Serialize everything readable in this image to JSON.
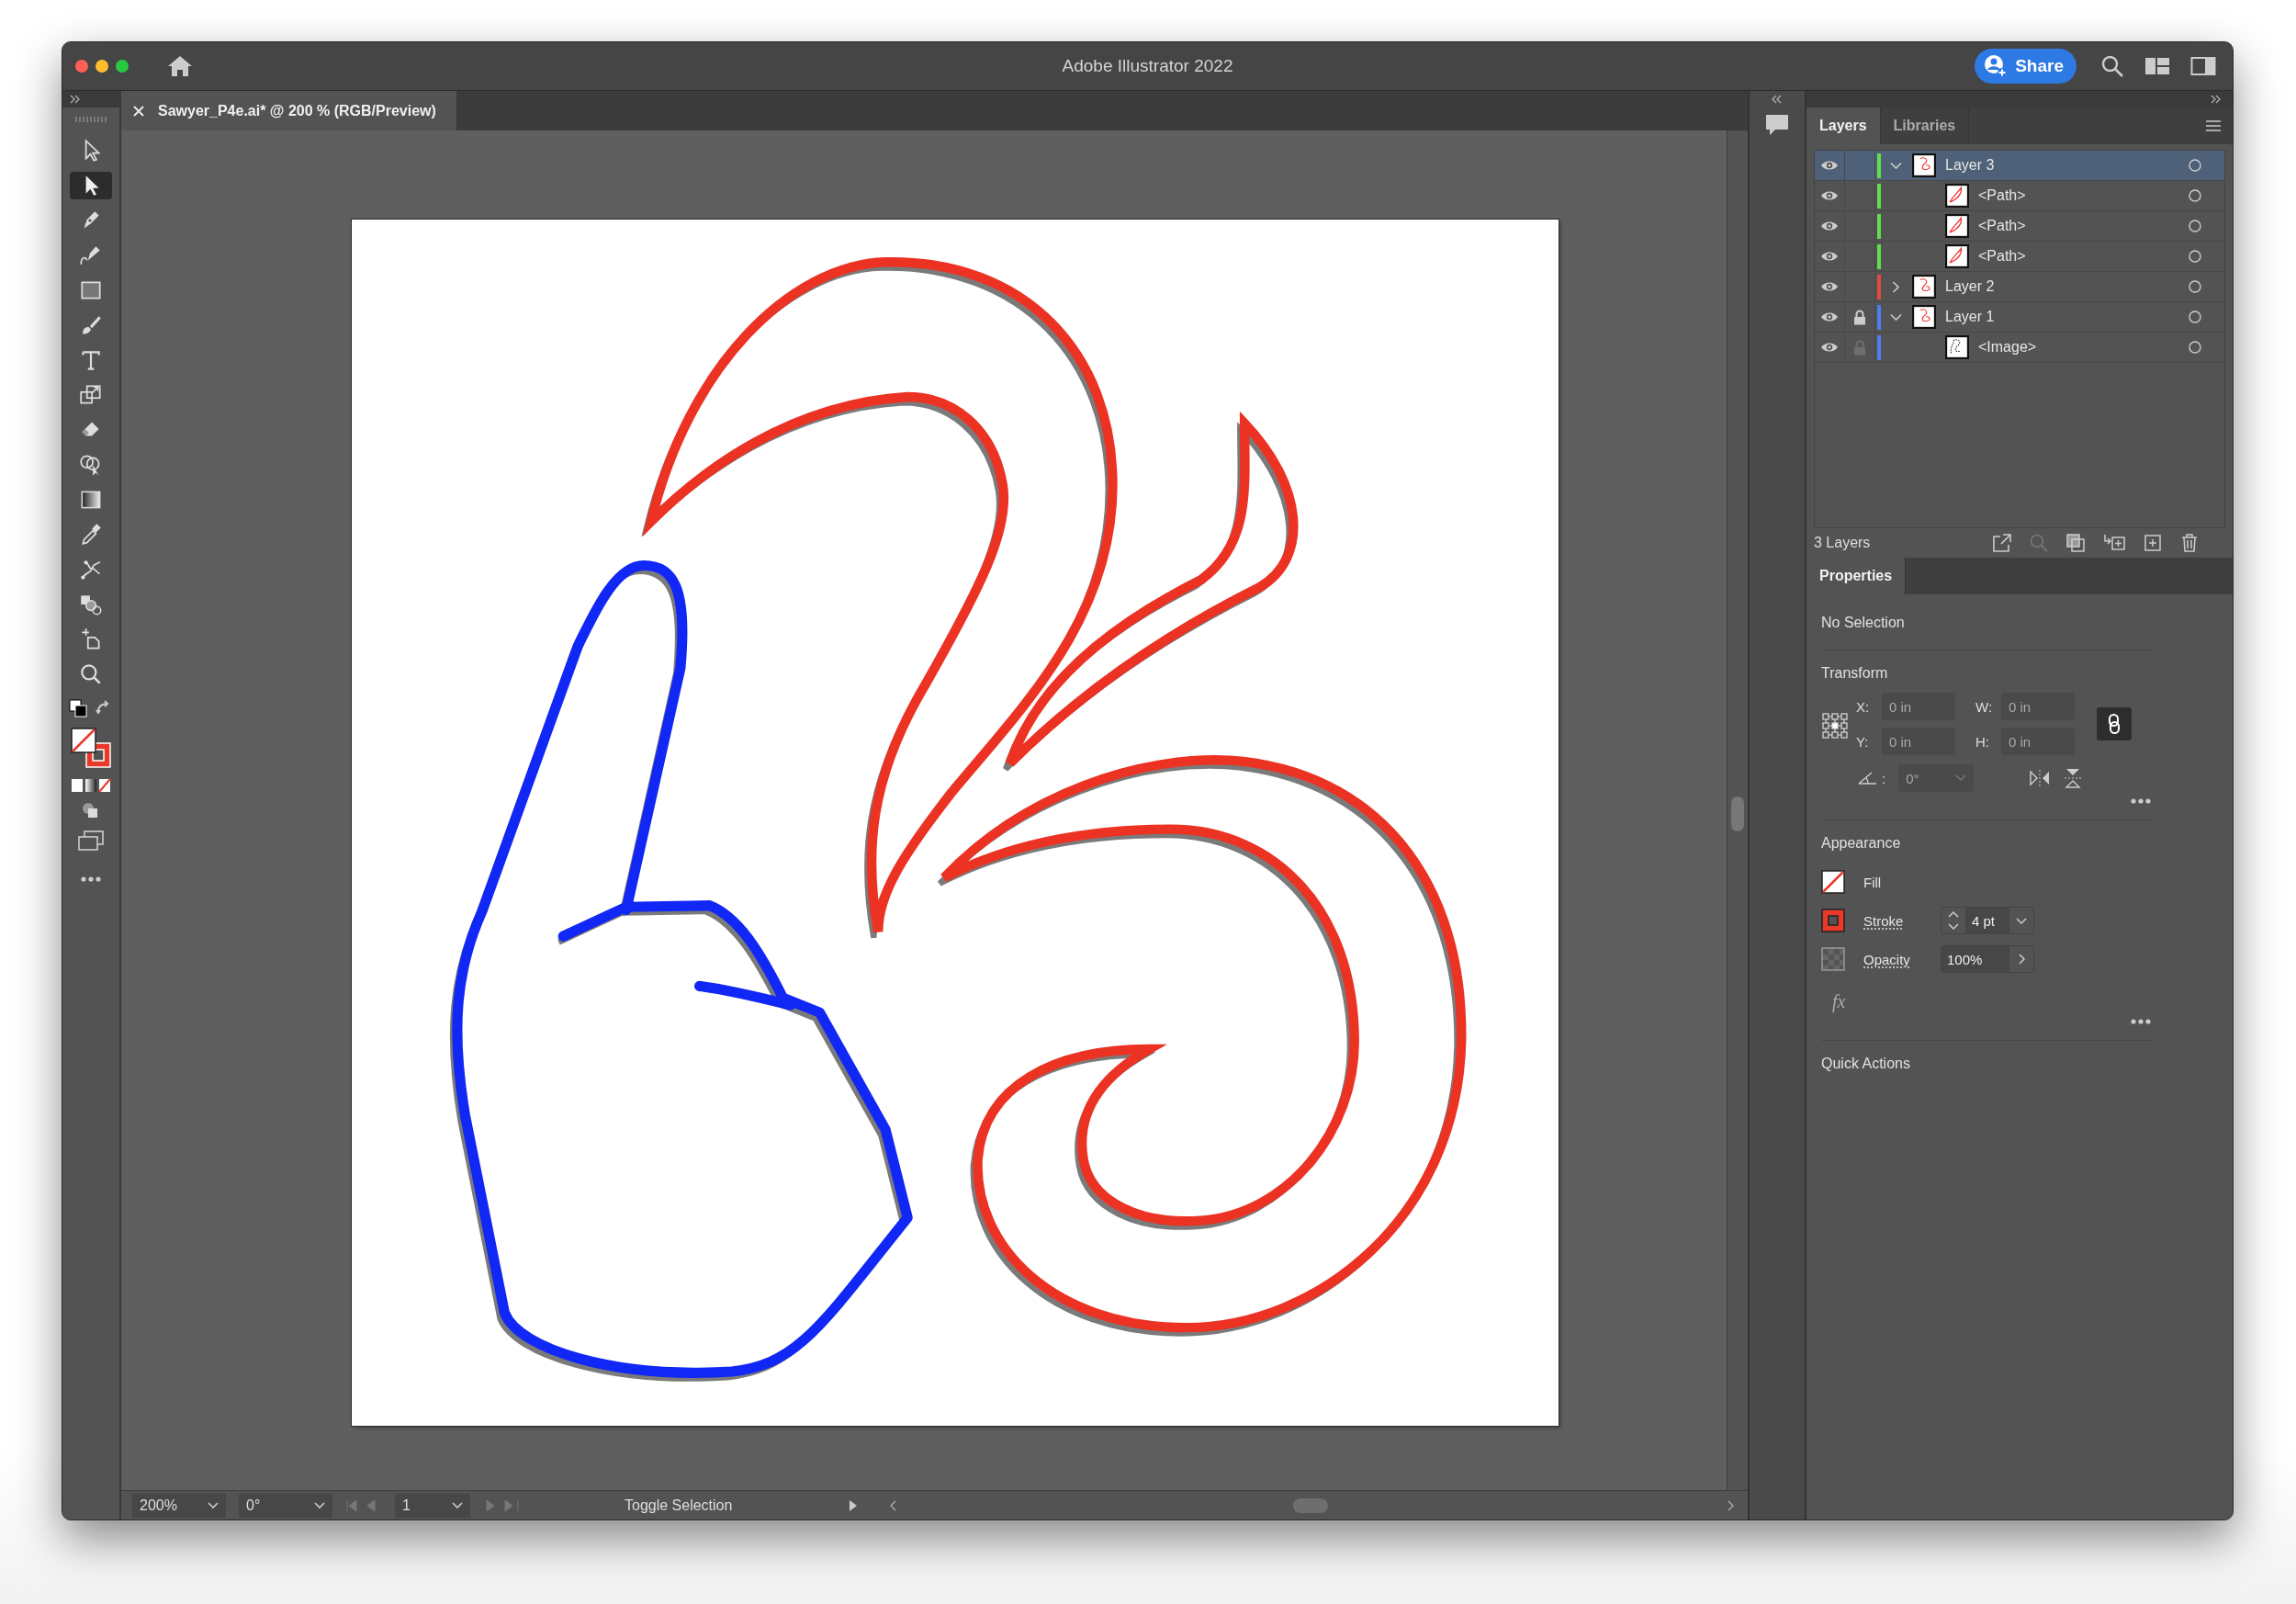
{
  "window": {
    "title": "Adobe Illustrator 2022"
  },
  "share_button": {
    "label": "Share"
  },
  "document_tab": {
    "title": "Sawyer_P4e.ai* @ 200 % (RGB/Preview)"
  },
  "tools": [
    {
      "kind": "selection",
      "selected": false
    },
    {
      "kind": "direct-selection",
      "selected": true
    },
    {
      "kind": "pen",
      "selected": false
    },
    {
      "kind": "curvature",
      "selected": false
    },
    {
      "kind": "rectangle",
      "selected": false
    },
    {
      "kind": "paintbrush",
      "selected": false
    },
    {
      "kind": "type",
      "selected": false
    },
    {
      "kind": "scale",
      "selected": false
    },
    {
      "kind": "eraser",
      "selected": false
    },
    {
      "kind": "shape-builder",
      "selected": false
    },
    {
      "kind": "gradient",
      "selected": false
    },
    {
      "kind": "eyedropper",
      "selected": false
    },
    {
      "kind": "puppet-warp",
      "selected": false
    },
    {
      "kind": "shapes",
      "selected": false
    },
    {
      "kind": "artboard",
      "selected": false
    },
    {
      "kind": "zoom",
      "selected": false
    }
  ],
  "layers_panel": {
    "tabs": [
      {
        "label": "Layers",
        "selected": true
      },
      {
        "label": "Libraries",
        "selected": false
      }
    ],
    "layers": [
      {
        "name": "Layer 3",
        "kind": "layer",
        "color": "#5fe04c",
        "visible": true,
        "locked": false,
        "expanded": true,
        "selected": true,
        "children": [
          {
            "name": "<Path>",
            "kind": "path",
            "color": "#5fe04c",
            "visible": true,
            "locked": false,
            "selected": false
          },
          {
            "name": "<Path>",
            "kind": "path",
            "color": "#5fe04c",
            "visible": true,
            "locked": false,
            "selected": false
          },
          {
            "name": "<Path>",
            "kind": "path",
            "color": "#5fe04c",
            "visible": true,
            "locked": false,
            "selected": false
          }
        ]
      },
      {
        "name": "Layer 2",
        "kind": "layer",
        "color": "#e8473d",
        "visible": true,
        "locked": false,
        "expanded": false,
        "selected": false
      },
      {
        "name": "Layer 1",
        "kind": "layer",
        "color": "#4d7ef2",
        "visible": true,
        "locked": true,
        "expanded": true,
        "selected": false,
        "children": [
          {
            "name": "<Image>",
            "kind": "image",
            "color": "#4d7ef2",
            "visible": true,
            "locked": false,
            "selected": false
          }
        ]
      }
    ],
    "footer": "3 Layers"
  },
  "properties_panel": {
    "tab": "Properties",
    "selection": "No Selection",
    "transform": {
      "title": "Transform",
      "fields": [
        {
          "label": "X:",
          "value": "0 in",
          "disabled": true
        },
        {
          "label": "W:",
          "value": "0 in",
          "disabled": true
        },
        {
          "label": "Y:",
          "value": "0 in",
          "disabled": true
        },
        {
          "label": "H:",
          "value": "0 in",
          "disabled": true
        }
      ],
      "angle": {
        "label": ":",
        "value": "0°",
        "disabled": true
      }
    },
    "appearance": {
      "title": "Appearance",
      "rows": [
        {
          "kind": "fill",
          "label": "Fill"
        },
        {
          "kind": "stroke",
          "label": "Stroke",
          "value": "4 pt"
        },
        {
          "kind": "opacity",
          "label": "Opacity",
          "value": "100%"
        }
      ],
      "effects": "fx"
    },
    "quick_actions": {
      "title": "Quick Actions"
    }
  },
  "status_bar": {
    "zoom": "200%",
    "rotation": "0°",
    "artboard": "1",
    "info": "Toggle Selection"
  }
}
